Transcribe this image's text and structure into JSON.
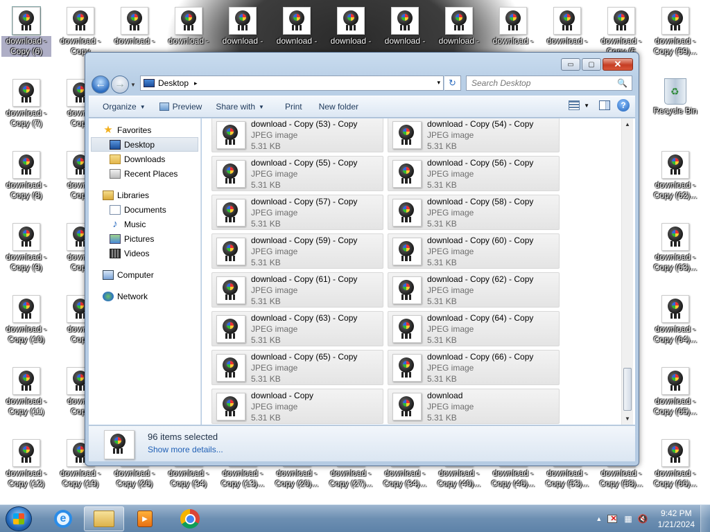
{
  "desktop": {
    "icons_top_row": [
      {
        "label1": "download -",
        "label2": "Copy (6)",
        "selected": true
      },
      {
        "label1": "download -",
        "label2": "Copy"
      },
      {
        "label1": "download -",
        "label2": ""
      },
      {
        "label1": "download -",
        "label2": ""
      },
      {
        "label1": "download -",
        "label2": ""
      },
      {
        "label1": "download -",
        "label2": ""
      },
      {
        "label1": "download -",
        "label2": ""
      },
      {
        "label1": "download -",
        "label2": ""
      },
      {
        "label1": "download -",
        "label2": ""
      },
      {
        "label1": "download -",
        "label2": ""
      },
      {
        "label1": "download -",
        "label2": ""
      },
      {
        "label1": "download -",
        "label2": "Copy (5"
      },
      {
        "label1": "download -",
        "label2": "Copy (59)..."
      }
    ],
    "icons_col1": [
      {
        "label1": "download -",
        "label2": "Copy (7)"
      },
      {
        "label1": "download -",
        "label2": "Copy (8)"
      },
      {
        "label1": "download -",
        "label2": "Copy (9)"
      },
      {
        "label1": "download -",
        "label2": "Copy (10)"
      },
      {
        "label1": "download -",
        "label2": "Copy (11)"
      },
      {
        "label1": "download -",
        "label2": "Copy (12)"
      }
    ],
    "icons_col2": [
      {
        "label1": "downlo",
        "label2": "Copy"
      },
      {
        "label1": "downlo",
        "label2": "Copy"
      },
      {
        "label1": "downlo",
        "label2": "Copy"
      },
      {
        "label1": "downlo",
        "label2": "Copy"
      },
      {
        "label1": "downlo",
        "label2": "Copy"
      }
    ],
    "icons_right_col": [
      {
        "label1": "Recycle Bin",
        "label2": "",
        "bin": true
      },
      {
        "label1": "download -",
        "label2": "Copy (62)..."
      },
      {
        "label1": "download -",
        "label2": "Copy (63)..."
      },
      {
        "label1": "download -",
        "label2": "Copy (64)..."
      },
      {
        "label1": "download -",
        "label2": "Copy (65)..."
      },
      {
        "label1": "download -",
        "label2": "Copy (66)..."
      }
    ],
    "icons_bottom_row": [
      {
        "label1": "download -",
        "label2": "Copy (19)"
      },
      {
        "label1": "download -",
        "label2": "Copy (26)"
      },
      {
        "label1": "download -",
        "label2": "Copy (34)"
      },
      {
        "label1": "download -",
        "label2": "Copy (13)..."
      },
      {
        "label1": "download -",
        "label2": "Copy (20)..."
      },
      {
        "label1": "download -",
        "label2": "Copy (27)..."
      },
      {
        "label1": "download -",
        "label2": "Copy (34)..."
      },
      {
        "label1": "download -",
        "label2": "Copy (40)..."
      },
      {
        "label1": "download -",
        "label2": "Copy (46)..."
      },
      {
        "label1": "download -",
        "label2": "Copy (53)..."
      },
      {
        "label1": "download -",
        "label2": "Copy (58)..."
      }
    ]
  },
  "window": {
    "caption_buttons": {
      "minimize": "▭",
      "maximize": "▢",
      "close": "✕"
    },
    "address": {
      "location": "Desktop",
      "separator": "▸",
      "dropdown": "▾"
    },
    "refresh_glyph": "↻",
    "search": {
      "placeholder": "Search Desktop",
      "icon": "🔍"
    },
    "toolbar": {
      "organize": "Organize",
      "preview": "Preview",
      "share_with": "Share with",
      "print": "Print",
      "new_folder": "New folder",
      "dropdown_arrow": "▼",
      "help": "?"
    },
    "nav": {
      "favorites": "Favorites",
      "desktop": "Desktop",
      "downloads": "Downloads",
      "recent_places": "Recent Places",
      "libraries": "Libraries",
      "documents": "Documents",
      "music": "Music",
      "pictures": "Pictures",
      "videos": "Videos",
      "computer": "Computer",
      "network": "Network"
    },
    "files": [
      {
        "name": "download - Copy (53) - Copy",
        "type": "JPEG image",
        "size": "5.31 KB"
      },
      {
        "name": "download - Copy (54) - Copy",
        "type": "JPEG image",
        "size": "5.31 KB"
      },
      {
        "name": "download - Copy (55) - Copy",
        "type": "JPEG image",
        "size": "5.31 KB"
      },
      {
        "name": "download - Copy (56) - Copy",
        "type": "JPEG image",
        "size": "5.31 KB"
      },
      {
        "name": "download - Copy (57) - Copy",
        "type": "JPEG image",
        "size": "5.31 KB"
      },
      {
        "name": "download - Copy (58) - Copy",
        "type": "JPEG image",
        "size": "5.31 KB"
      },
      {
        "name": "download - Copy (59) - Copy",
        "type": "JPEG image",
        "size": "5.31 KB"
      },
      {
        "name": "download - Copy (60) - Copy",
        "type": "JPEG image",
        "size": "5.31 KB"
      },
      {
        "name": "download - Copy (61) - Copy",
        "type": "JPEG image",
        "size": "5.31 KB"
      },
      {
        "name": "download - Copy (62) - Copy",
        "type": "JPEG image",
        "size": "5.31 KB"
      },
      {
        "name": "download - Copy (63) - Copy",
        "type": "JPEG image",
        "size": "5.31 KB"
      },
      {
        "name": "download - Copy (64) - Copy",
        "type": "JPEG image",
        "size": "5.31 KB"
      },
      {
        "name": "download - Copy (65) - Copy",
        "type": "JPEG image",
        "size": "5.31 KB"
      },
      {
        "name": "download - Copy (66) - Copy",
        "type": "JPEG image",
        "size": "5.31 KB"
      },
      {
        "name": "download - Copy",
        "type": "JPEG image",
        "size": "5.31 KB"
      },
      {
        "name": "download",
        "type": "JPEG image",
        "size": "5.31 KB"
      }
    ],
    "details": {
      "count": "96 items selected",
      "more": "Show more details..."
    }
  },
  "taskbar": {
    "clock_time": "9:42 PM",
    "clock_date": "1/21/2024",
    "tray_arrow": "▲",
    "ie_glyph": "e",
    "media_glyph": "▶"
  }
}
